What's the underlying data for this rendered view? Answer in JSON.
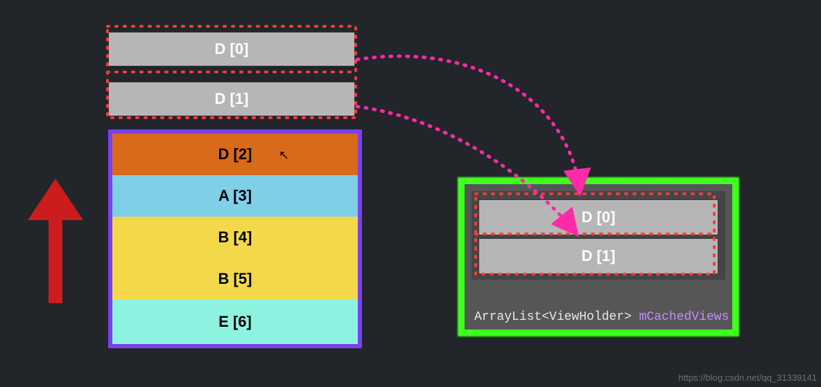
{
  "scrap_rows": [
    {
      "label": "D [0]"
    },
    {
      "label": "D [1]"
    }
  ],
  "viewport_rows": [
    {
      "label": "D [2]",
      "color": "#d96a19"
    },
    {
      "label": "A [3]",
      "color": "#7fcfe8"
    },
    {
      "label": "B [4]",
      "color": "#f3d94a"
    },
    {
      "label": "B [5]",
      "color": "#f3d94a"
    },
    {
      "label": "E [6]",
      "color": "#8ef2e0"
    }
  ],
  "cache": {
    "items": [
      {
        "label": "D [0]"
      },
      {
        "label": "D [1]"
      }
    ],
    "type_text": "ArrayList<ViewHolder>",
    "field_name": "mCachedViews"
  },
  "arrow": {
    "direction": "up",
    "color": "#cb1d1d",
    "meaning": "scroll direction"
  },
  "connectors": [
    {
      "from": "scrap_rows.0",
      "to": "cache.items.0",
      "style": "magenta-dotted-arrow"
    },
    {
      "from": "scrap_rows.1",
      "to": "cache.items.1",
      "style": "magenta-dotted-arrow"
    }
  ],
  "colors": {
    "background": "#22262a",
    "viewport_border": "#7a3ff2",
    "cache_border": "#3fff1e",
    "scrap_fill": "#b6b6b6",
    "connector": "#ff2aa8",
    "selection_dots": "#ff3a3a",
    "field_name": "#c48cff"
  },
  "watermark": "https://blog.csdn.net/qq_31339141"
}
